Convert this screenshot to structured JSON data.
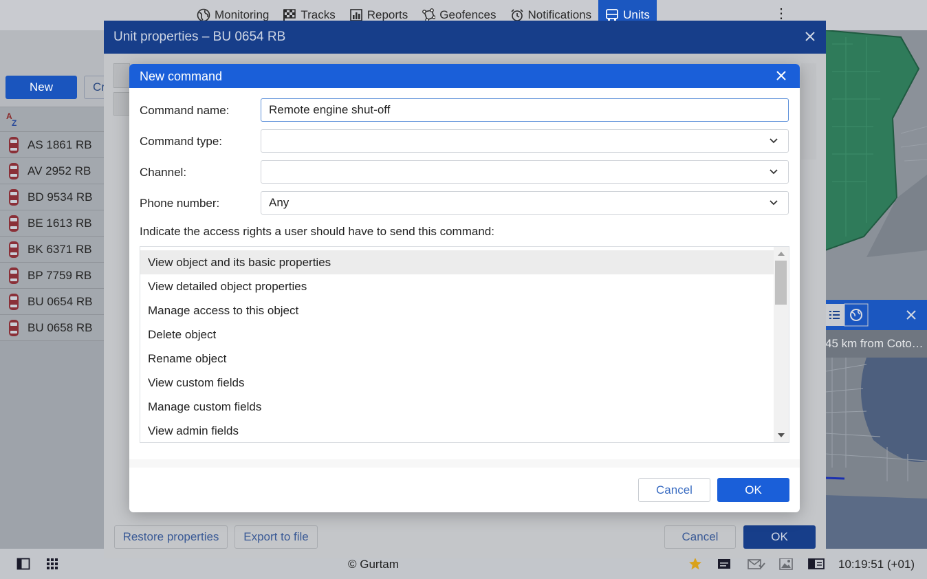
{
  "topnav": {
    "tabs": [
      {
        "label": "Monitoring",
        "icon": "globe-icon",
        "active": false
      },
      {
        "label": "Tracks",
        "icon": "checkered-flag-icon",
        "active": false
      },
      {
        "label": "Reports",
        "icon": "chart-report-icon",
        "active": false
      },
      {
        "label": "Geofences",
        "icon": "geofence-icon",
        "active": false
      },
      {
        "label": "Notifications",
        "icon": "alarm-clock-icon",
        "active": false
      },
      {
        "label": "Units",
        "icon": "bus-icon",
        "active": true
      }
    ]
  },
  "leftpanel": {
    "new_label": "New",
    "create_label": "Cr",
    "units": [
      "AS 1861 RB",
      "AV 2952 RB",
      "BD 9534 RB",
      "BE 1613 RB",
      "BK 6371 RB",
      "BP 7759 RB",
      "BU 0654 RB",
      "BU 0658 RB"
    ]
  },
  "map": {
    "address": "45 km from Coto…"
  },
  "unit_properties": {
    "title": "Unit properties – BU 0654 RB",
    "restore_label": "Restore properties",
    "export_label": "Export to file",
    "cancel_label": "Cancel",
    "ok_label": "OK"
  },
  "new_command": {
    "title": "New command",
    "command_name_label": "Command name:",
    "command_name_value": "Remote engine shut-off",
    "command_type_label": "Command type:",
    "command_type_value": "",
    "channel_label": "Channel:",
    "channel_value": "",
    "phone_label": "Phone number:",
    "phone_value": "Any",
    "rights_hint": "Indicate the access rights a user should have to send this command:",
    "rights": [
      "View object and its basic properties",
      "View detailed object properties",
      "Manage access to this object",
      "Delete object",
      "Rename object",
      "View custom fields",
      "Manage custom fields",
      "View admin fields"
    ],
    "cancel_label": "Cancel",
    "ok_label": "OK"
  },
  "statusbar": {
    "copyright": "© Gurtam",
    "clock": "10:19:51 (+01)"
  },
  "colors": {
    "accent": "#1a5fd9",
    "dim_header": "#173e8a"
  }
}
